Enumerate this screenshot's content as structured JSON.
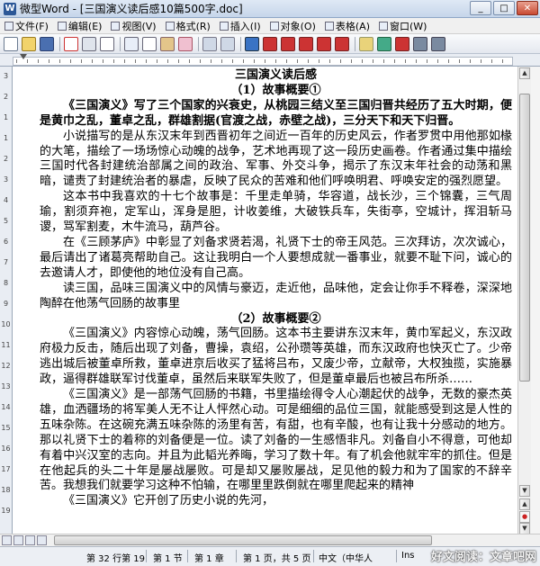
{
  "window": {
    "app_icon": "W",
    "title": "微型Word - [三国演义读后感10篇500字.doc]"
  },
  "window_buttons": {
    "minimize": "_",
    "maximize": "□",
    "close": "✕"
  },
  "menu": [
    {
      "label": "文件(F)"
    },
    {
      "label": "编辑(E)"
    },
    {
      "label": "视图(V)"
    },
    {
      "label": "格式(R)"
    },
    {
      "label": "插入(I)"
    },
    {
      "label": "对象(O)"
    },
    {
      "label": "表格(A)"
    },
    {
      "label": "窗口(W)"
    }
  ],
  "ruler_labels": [
    "3",
    "2",
    "1",
    "1",
    "2",
    "3",
    "4",
    "5",
    "6",
    "7",
    "8",
    "9",
    "10",
    "11",
    "12",
    "13",
    "14",
    "15",
    "16",
    "17",
    "18",
    "19"
  ],
  "document": {
    "heading": "三国演义读后感",
    "section1": "（1）故事概要①",
    "intro": "《三国演义》写了三个国家的兴衰史，从桃园三结义至三国归晋共经历了五大时期，便是黄巾之乱，董卓之乱，群雄割据(官渡之战，赤壁之战)，三分天下和天下归晋。",
    "p1": "小说描写的是从东汉末年到西晋初年之间近一百年的历史风云，作者罗贯中用他那如椽的大笔，描绘了一场场惊心动魄的战争，艺术地再现了这一段历史画卷。作者通过集中描绘三国时代各封建统治部属之间的政治、军事、外交斗争，揭示了东汉末年社会的动荡和黑暗，谴责了封建统治者的暴虐，反映了民众的苦难和他们呼唤明君、呼唤安定的强烈愿望。",
    "p2": "这本书中我喜欢的十七个故事是：千里走单骑，华容道，战长沙，三个锦囊，三气周瑜，割须弃袍，定军山，浑身是胆，计收姜维，大破铁兵车，失街亭，空城计，挥泪斩马谡，骂军割麦，木牛流马，葫芦谷。",
    "p3": "在《三顾茅庐》中彰显了刘备求贤若渴，礼贤下士的帝王风范。三次拜访，次次诚心，最后请出了诸葛亮帮助自己。这让我明白一个人要想成就一番事业，就要不耻下问，诚心的去邀请人才，即使他的地位没有自己高。",
    "p4": "读三国，品味三国演义中的风情与豪迈，走近他，品味他，定会让你手不释卷，深深地陶醉在他荡气回肠的故事里",
    "section2": "（2）故事概要②",
    "p5": "《三国演义》内容惊心动魄，荡气回肠。这本书主要讲东汉末年，黄巾军起义，东汉政府极力反击，随后出现了刘备，曹操，袁绍，公孙瓒等英雄，而东汉政府也快灭亡了。少帝逃出城后被董卓所救，董卓进京后收买了猛将吕布，又废少帝，立献帝，大权独揽，实施暴政，逼得群雄联军讨伐董卓，虽然后来联军失败了，但是董卓最后也被吕布所杀……",
    "p6": "《三国演义》是一部荡气回肠的书籍，书里描绘得令人心潮起伏的战争，无数的豪杰英雄，血洒疆场的将军美人无不让人怦然心动。可是细细的品位三国，就能感受到这是人性的五味杂陈。在这碗充满五味杂陈的汤里有苦，有甜，也有辛酸，也有让我十分感动的地方。那以礼贤下士的着称的刘备便是一位。读了刘备的一生感悟非凡。刘备自小不得意，可他却有着中兴汉室的志向。并且为此韬光养晦，学习了数十年。有了机会他就牢牢的抓住。但是在他起兵的头二十年是屡战屡败。可是却又屡败屡战，足见他的毅力和为了国家的不辞辛苦。我想我们就要学习这种不怕输，在哪里里跌倒就在哪里爬起来的精神",
    "p7": "《三国演义》它开创了历史小说的先河，"
  },
  "status": {
    "page_info": "第 32 行第 19",
    "section": "第 1 节",
    "chapter": "第 1 章",
    "page": "第 1 页，共 5 页",
    "language": "中文（中华人",
    "mode": "Ins"
  },
  "watermark": "好文阅读：文章吧网"
}
